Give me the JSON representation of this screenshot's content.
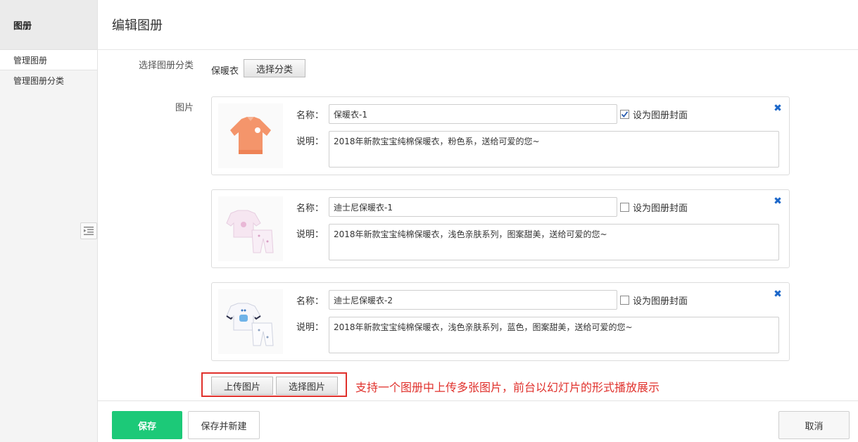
{
  "sidebar": {
    "title": "图册",
    "items": [
      {
        "label": "管理图册"
      },
      {
        "label": "管理图册分类"
      }
    ]
  },
  "header": {
    "title": "编辑图册"
  },
  "form": {
    "category_label": "选择图册分类",
    "category_value": "保暖衣",
    "choose_category_button": "选择分类",
    "pictures_label": "图片",
    "name_label": "名称：",
    "desc_label": "说明：",
    "cover_label": "设为图册封面",
    "pictures": [
      {
        "name": "保暖衣-1",
        "description": "2018年新款宝宝纯棉保暖衣，粉色系，送给可爱的您~",
        "is_cover": true,
        "thumb_icon": "orange-sweater-icon"
      },
      {
        "name": "迪士尼保暖衣-1",
        "description": "2018年新款宝宝纯棉保暖衣，浅色亲肤系列，图案甜美，送给可爱的您~",
        "is_cover": false,
        "thumb_icon": "pink-pajama-set-icon"
      },
      {
        "name": "迪士尼保暖衣-2",
        "description": "2018年新款宝宝纯棉保暖衣，浅色亲肤系列，蓝色，图案甜美，送给可爱的您~",
        "is_cover": false,
        "thumb_icon": "white-pajama-set-icon"
      }
    ],
    "upload_button": "上传图片",
    "select_picture_button": "选择图片",
    "annotation": "支持一个图册中上传多张图片，前台以幻灯片的形式播放展示"
  },
  "footer": {
    "save": "保存",
    "save_and_new": "保存并新建",
    "cancel": "取消"
  },
  "colors": {
    "primary_green": "#1cc978",
    "annotation_red": "#e0312c",
    "close_blue": "#1a66c9"
  }
}
